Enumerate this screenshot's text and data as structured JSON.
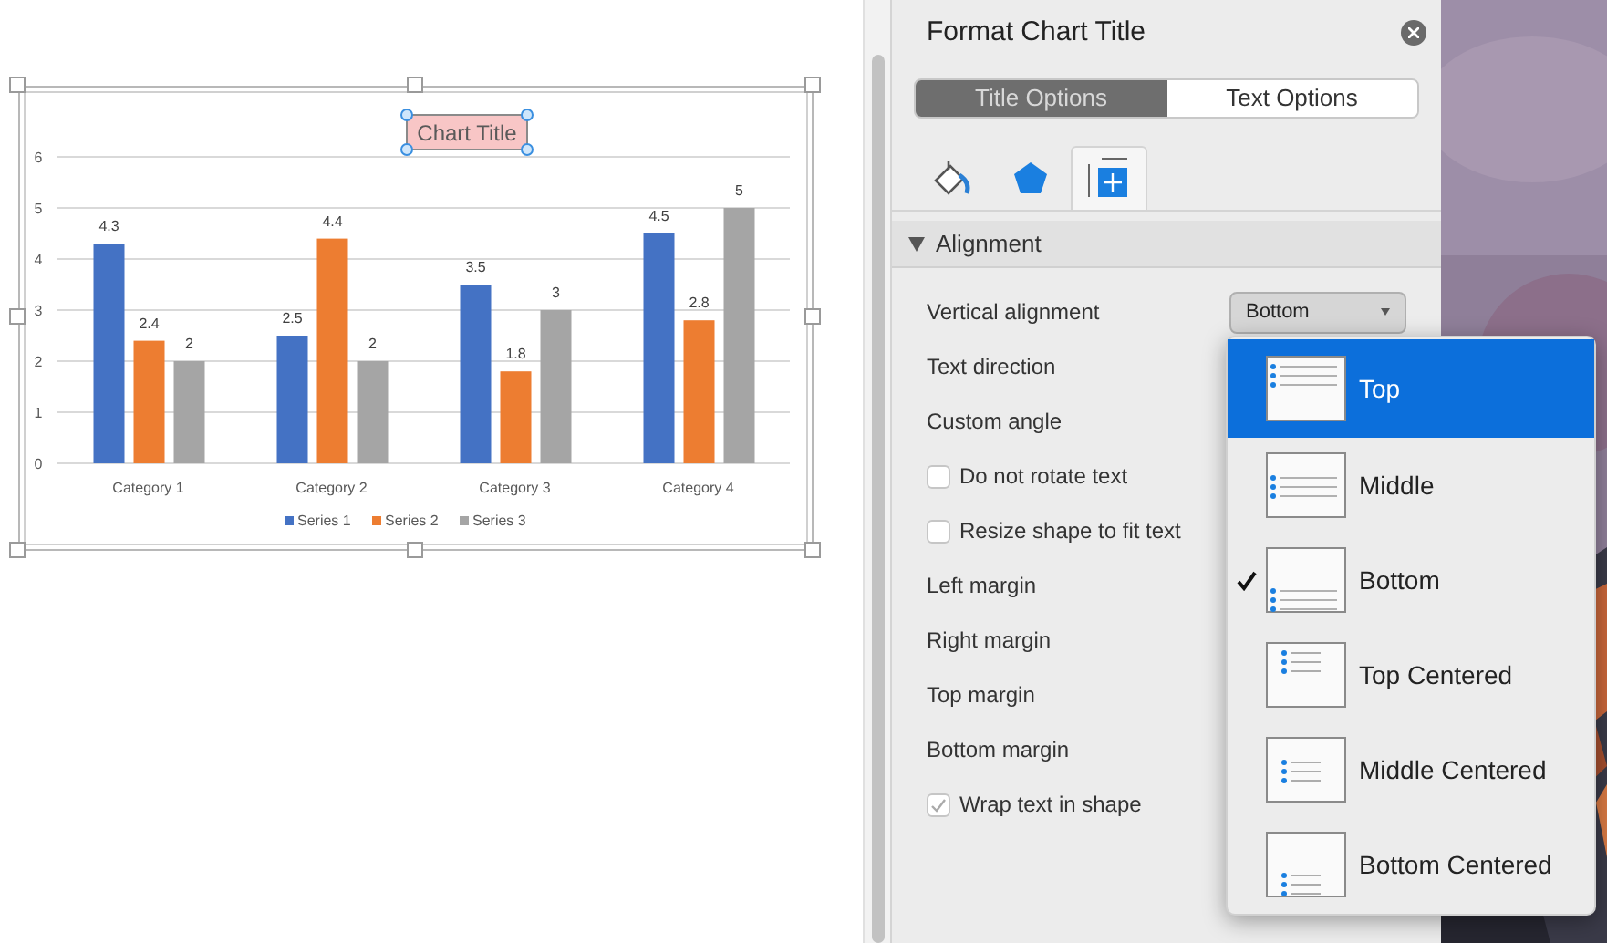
{
  "chart": {
    "chart_data": {
      "type": "bar",
      "title": "Chart Title",
      "categories": [
        "Category 1",
        "Category 2",
        "Category 3",
        "Category 4"
      ],
      "series": [
        {
          "name": "Series 1",
          "color": "#4472c4",
          "values": [
            4.3,
            2.5,
            3.5,
            4.5
          ]
        },
        {
          "name": "Series 2",
          "color": "#ed7d31",
          "values": [
            2.4,
            4.4,
            1.8,
            2.8
          ]
        },
        {
          "name": "Series 3",
          "color": "#a5a5a5",
          "values": [
            2,
            2,
            3,
            5
          ]
        }
      ],
      "ylim": [
        0,
        6
      ],
      "yticks": [
        0,
        1,
        2,
        3,
        4,
        5,
        6
      ],
      "data_labels": true,
      "grid": true,
      "legend": "bottom"
    },
    "title_selected": true
  },
  "panel": {
    "title": "Format Chart Title",
    "segments": [
      {
        "label": "Title Options",
        "selected": true
      },
      {
        "label": "Text Options",
        "selected": false
      }
    ],
    "icon_tabs": [
      {
        "kind": "fill",
        "selected": false
      },
      {
        "kind": "effects",
        "selected": false
      },
      {
        "kind": "layout",
        "selected": true
      }
    ],
    "section": {
      "label": "Alignment",
      "expanded": true
    },
    "rows": [
      {
        "kind": "select",
        "label": "Vertical alignment",
        "value": "Bottom"
      },
      {
        "kind": "label",
        "label": "Text direction"
      },
      {
        "kind": "label",
        "label": "Custom angle"
      },
      {
        "kind": "checkbox",
        "label": "Do not rotate text",
        "checked": false
      },
      {
        "kind": "checkbox",
        "label": "Resize shape to fit text",
        "checked": false
      },
      {
        "kind": "label",
        "label": "Left margin"
      },
      {
        "kind": "label",
        "label": "Right margin"
      },
      {
        "kind": "label",
        "label": "Top margin"
      },
      {
        "kind": "label",
        "label": "Bottom margin"
      },
      {
        "kind": "checkbox",
        "label": "Wrap text in shape",
        "checked": true
      }
    ]
  },
  "menu": [
    {
      "kind": "top",
      "label": "Top",
      "selected": true,
      "checked": false
    },
    {
      "kind": "middle",
      "label": "Middle",
      "selected": false,
      "checked": false
    },
    {
      "kind": "bottom",
      "label": "Bottom",
      "selected": false,
      "checked": true
    },
    {
      "kind": "top-centered",
      "label": "Top Centered",
      "selected": false,
      "checked": false
    },
    {
      "kind": "middle-centered",
      "label": "Middle Centered",
      "selected": false,
      "checked": false
    },
    {
      "kind": "bottom-centered",
      "label": "Bottom Centered",
      "selected": false,
      "checked": false
    }
  ]
}
